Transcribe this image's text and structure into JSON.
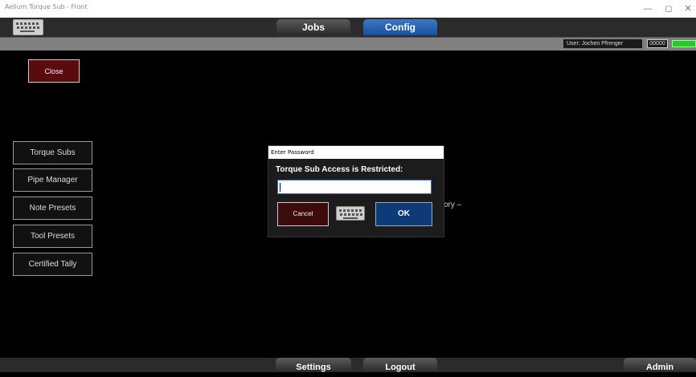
{
  "window": {
    "title": "Aelium Torque Sub - Front",
    "controls": [
      "—",
      "◻",
      "✕"
    ]
  },
  "topnav": {
    "keyboard_icon": "keyboard-icon",
    "tabs": [
      {
        "label": "Jobs",
        "active": false
      },
      {
        "label": "Config",
        "active": true
      }
    ]
  },
  "status": {
    "user": "User: Jochen Pfrenger",
    "code": "00000",
    "led_color": "#22cc22"
  },
  "sidebar": {
    "close_label": "Close",
    "items": [
      {
        "label": "Torque Subs"
      },
      {
        "label": "Pipe Manager"
      },
      {
        "label": "Note Presets"
      },
      {
        "label": "Tool Presets"
      },
      {
        "label": "Certified Tally"
      }
    ]
  },
  "background_text": "ory –",
  "dialog": {
    "title": "Enter Password",
    "message": "Torque Sub Access is Restricted:",
    "password_value": "",
    "cancel_label": "Cancel",
    "keyboard_icon": "keyboard-icon",
    "ok_label": "OK"
  },
  "bottomnav": {
    "settings_label": "Settings",
    "logout_label": "Logout",
    "admin_label": "Admin"
  },
  "colors": {
    "accent": "#1a4f99",
    "close_red": "#5a0c0c",
    "ok_blue": "#0d3b7a"
  }
}
